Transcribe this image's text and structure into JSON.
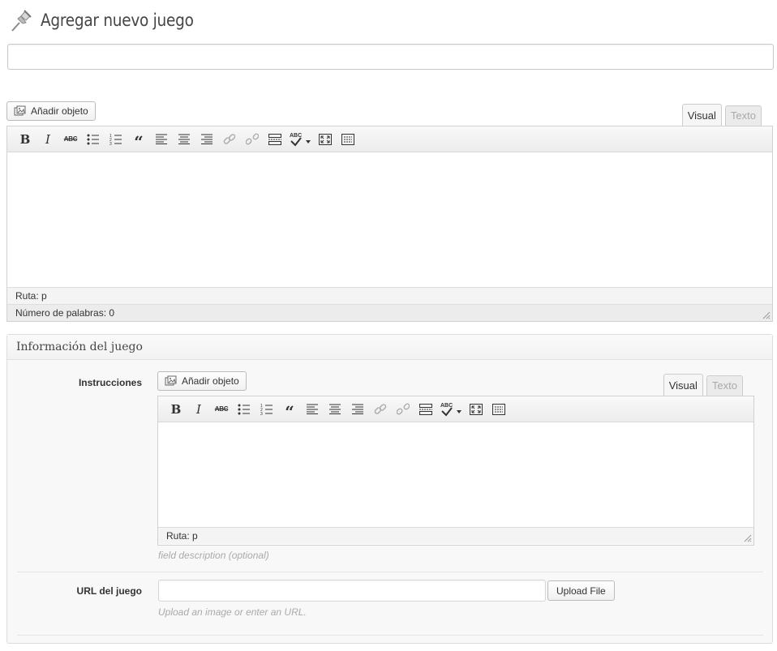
{
  "header": {
    "title": "Agregar nuevo juego",
    "icon": "pushpin-icon"
  },
  "title_field": {
    "value": "",
    "placeholder": ""
  },
  "main_editor": {
    "add_media_label": "Añadir objeto",
    "tabs": {
      "visual": "Visual",
      "text": "Texto",
      "active": "Visual"
    },
    "toolbar": [
      "bold",
      "italic",
      "strikethrough",
      "bullet-list",
      "numbered-list",
      "blockquote",
      "align-left",
      "align-center",
      "align-right",
      "link",
      "unlink",
      "more",
      "spellcheck",
      "fullscreen",
      "kitchen-sink"
    ],
    "content": "",
    "status_path": "Ruta: p",
    "word_count": "Número de palabras: 0"
  },
  "metabox": {
    "title": "Información del juego",
    "instructions": {
      "label": "Instrucciones",
      "add_media_label": "Añadir objeto",
      "tabs": {
        "visual": "Visual",
        "text": "Texto",
        "active": "Visual"
      },
      "content": "",
      "status_path": "Ruta: p",
      "description": "field description (optional)"
    },
    "url": {
      "label": "URL del juego",
      "value": "",
      "upload_label": "Upload File",
      "description": "Upload an image or enter an URL."
    }
  },
  "colors": {
    "text": "#333333",
    "muted": "#aaaaaa",
    "border": "#d1d1d1",
    "toolbar": "#ececec",
    "metabox_bg": "#f8f8f8"
  }
}
